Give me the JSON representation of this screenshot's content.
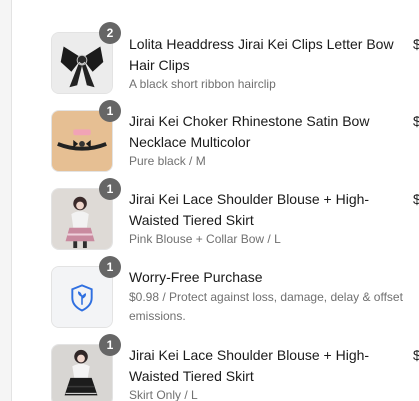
{
  "items": [
    {
      "quantity": "2",
      "title": "Lolita Headdress Jirai Kei Clips Letter Bow Hair Clips",
      "variant": "A black short ribbon hairclip",
      "price": "$"
    },
    {
      "quantity": "1",
      "title": "Jirai Kei Choker Rhinestone Satin Bow Necklace Multicolor",
      "variant": "Pure black / M",
      "price": "$"
    },
    {
      "quantity": "1",
      "title": "Jirai Kei Lace Shoulder Blouse + High-Waisted Tiered Skirt",
      "variant": "Pink Blouse + Collar Bow / L",
      "price": "$"
    },
    {
      "quantity": "1",
      "title": "Worry-Free Purchase",
      "variant": "$0.98 / Protect against loss, damage, delay & offset emissions.",
      "icon": "shield-leaf-icon",
      "accent": "#2f6fe0"
    },
    {
      "quantity": "1",
      "title": "Jirai Kei Lace Shoulder Blouse + High-Waisted Tiered Skirt",
      "variant": "Skirt Only / L",
      "price": "$"
    }
  ]
}
